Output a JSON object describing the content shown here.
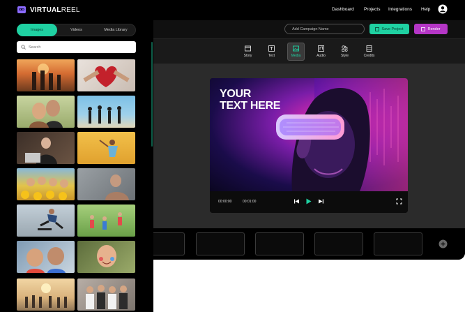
{
  "app": {
    "brand_bold": "VIRTUAL",
    "brand_light": "REEL"
  },
  "nav": {
    "items": [
      "Dashboard",
      "Projects",
      "Integrations",
      "Help"
    ]
  },
  "header": {
    "campaign_placeholder": "Add Campaign Name",
    "save_label": "Save Project",
    "render_label": "Render"
  },
  "tools": [
    {
      "label": "Story",
      "icon": "story-icon"
    },
    {
      "label": "Text",
      "icon": "text-icon"
    },
    {
      "label": "Media",
      "icon": "media-icon",
      "active": true
    },
    {
      "label": "Audio",
      "icon": "audio-icon"
    },
    {
      "label": "Style",
      "icon": "style-icon"
    },
    {
      "label": "Credits",
      "icon": "credits-icon"
    }
  ],
  "panel": {
    "tabs": [
      "Images",
      "Videos",
      "Media Library"
    ],
    "active_tab": "Images",
    "search_placeholder": "Search"
  },
  "video": {
    "overlay_line1": "YOUR",
    "overlay_line2": "TEXT HERE",
    "current_time": "00:00:00",
    "duration": "00:01:00"
  },
  "colors": {
    "accent": "#1fd1a2",
    "render": "#b536c6"
  }
}
